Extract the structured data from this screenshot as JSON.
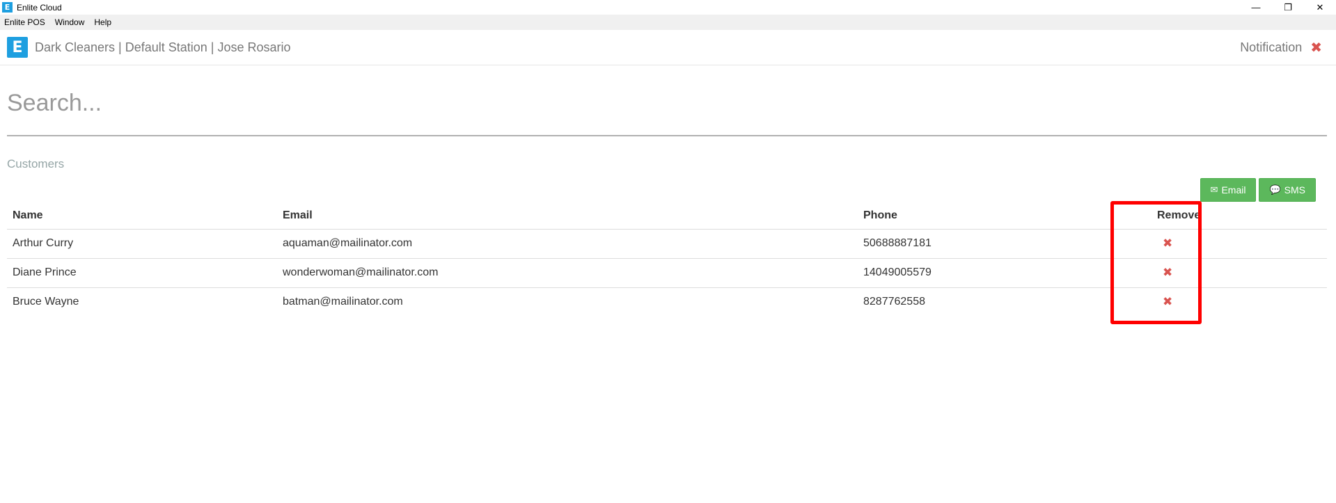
{
  "window": {
    "title": "Enlite Cloud",
    "app_icon_letter": "E",
    "controls": {
      "minimize": "—",
      "restore": "❐",
      "close": "✕"
    }
  },
  "menu": {
    "items": [
      "Enlite POS",
      "Window",
      "Help"
    ]
  },
  "header": {
    "logo_letter": "E",
    "title": "Dark Cleaners | Default Station | Jose Rosario",
    "notification_label": "Notification",
    "notification_close": "✖"
  },
  "search": {
    "placeholder": "Search..."
  },
  "customers": {
    "section_title": "Customers",
    "email_button": "Email",
    "sms_button": "SMS",
    "columns": [
      "Name",
      "Email",
      "Phone",
      "Remove"
    ],
    "rows": [
      {
        "name": "Arthur Curry",
        "email": "aquaman@mailinator.com",
        "phone": "50688887181"
      },
      {
        "name": "Diane Prince",
        "email": "wonderwoman@mailinator.com",
        "phone": "14049005579"
      },
      {
        "name": "Bruce Wayne",
        "email": "batman@mailinator.com",
        "phone": "8287762558"
      }
    ],
    "remove_glyph": "✖"
  },
  "icons": {
    "email": "envelope-icon",
    "sms": "comment-icon"
  },
  "colors": {
    "brand": "#1e9fe0",
    "danger": "#d9534f",
    "success": "#5cb85c",
    "highlight": "#ff0000"
  }
}
